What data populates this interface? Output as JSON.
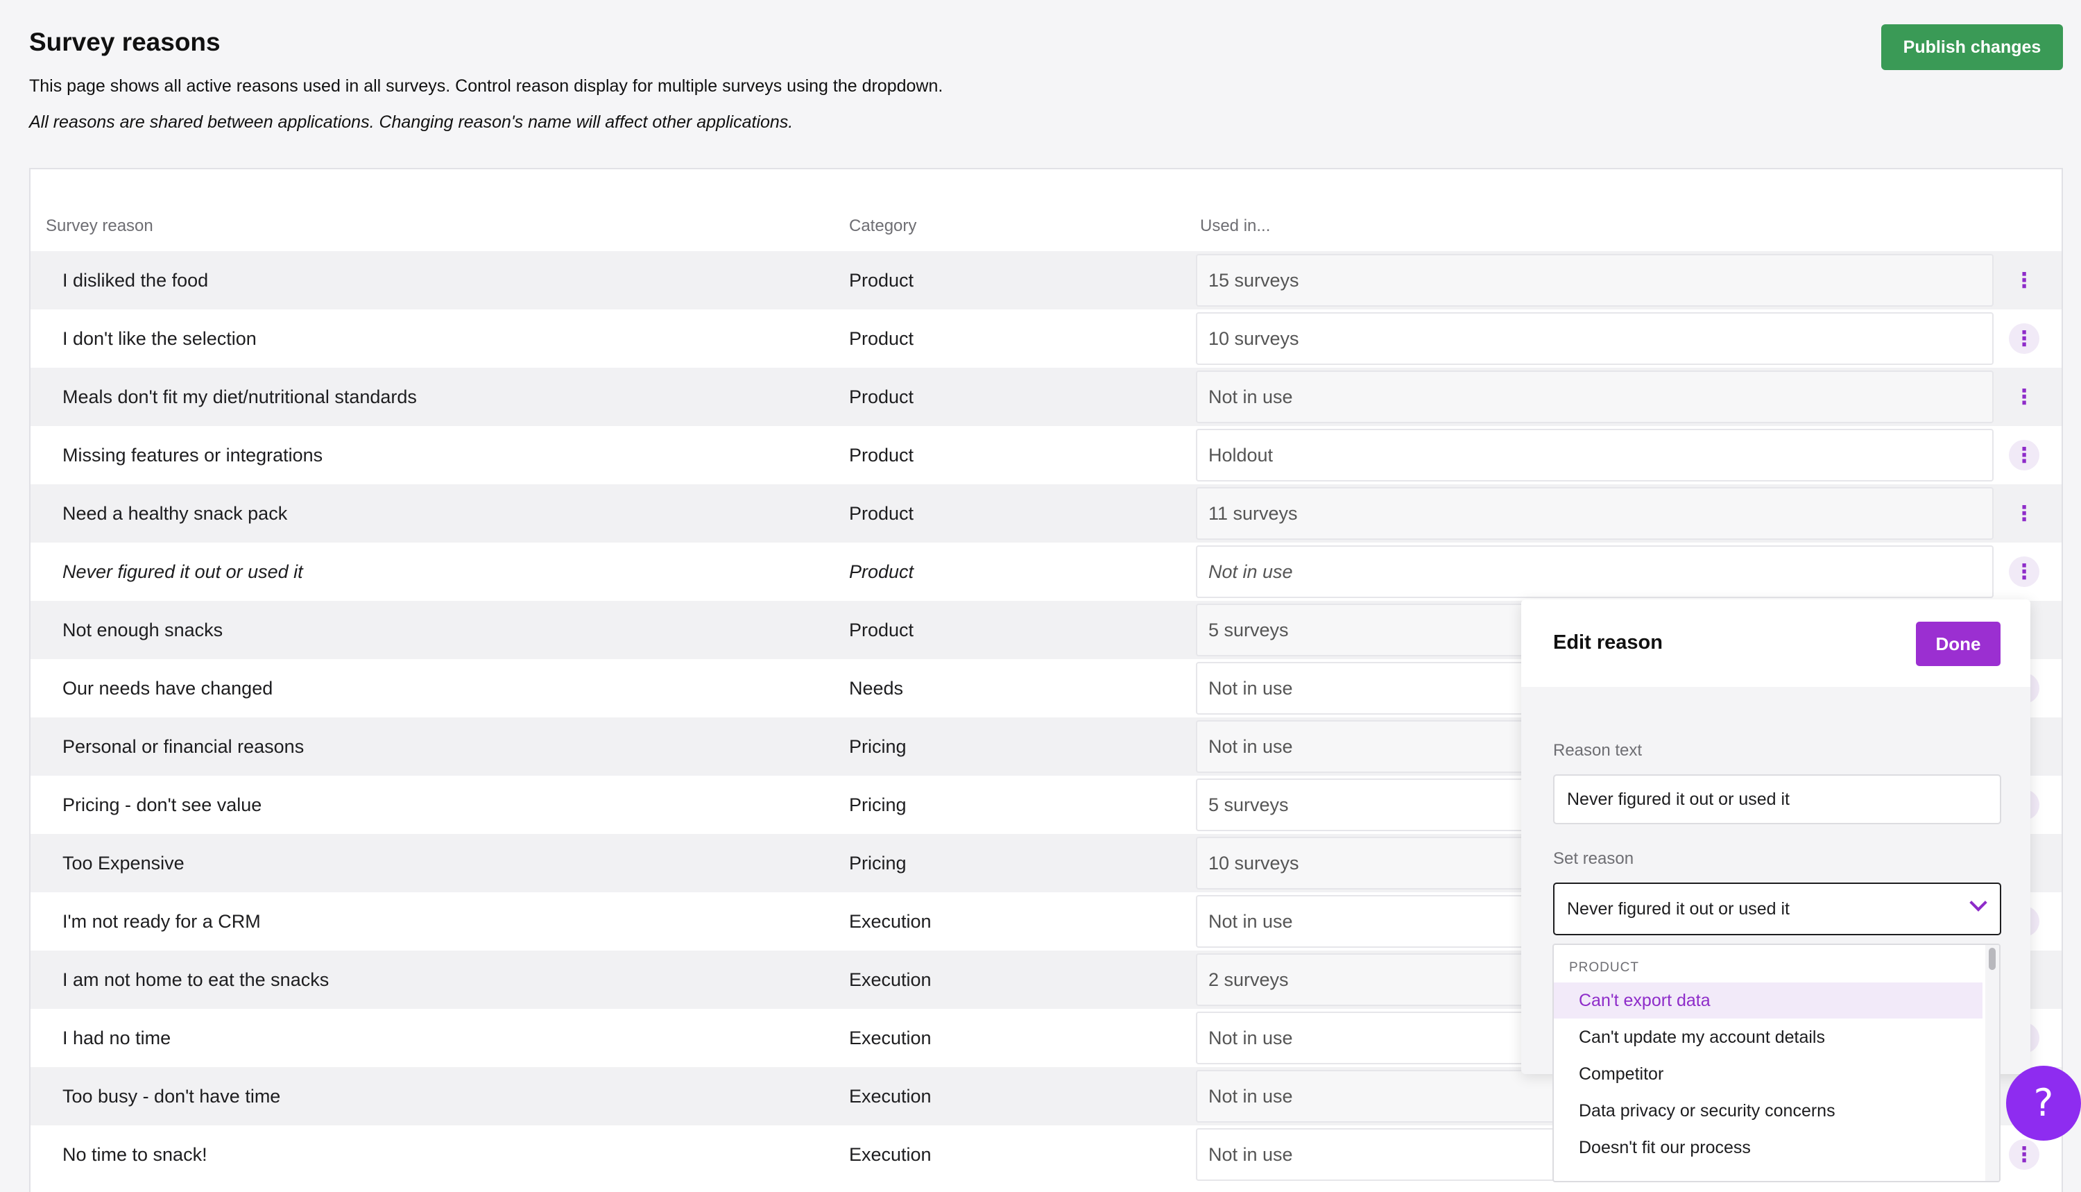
{
  "header": {
    "title": "Survey reasons",
    "subtitle": "This page shows all active reasons used in all surveys. Control reason display for multiple surveys using the dropdown.",
    "note": "All reasons are shared between applications. Changing reason's name will affect other applications.",
    "publish_label": "Publish changes"
  },
  "table": {
    "columns": {
      "reason": "Survey reason",
      "category": "Category",
      "used_in": "Used in..."
    },
    "rows": [
      {
        "reason": "I disliked the food",
        "category": "Product",
        "used_in": "15 surveys"
      },
      {
        "reason": "I don't like the selection",
        "category": "Product",
        "used_in": "10 surveys"
      },
      {
        "reason": "Meals don't fit my diet/nutritional standards",
        "category": "Product",
        "used_in": "Not in use"
      },
      {
        "reason": "Missing features or integrations",
        "category": "Product",
        "used_in": "Holdout"
      },
      {
        "reason": "Need a healthy snack pack",
        "category": "Product",
        "used_in": "11 surveys"
      },
      {
        "reason": "Never figured it out or used it",
        "category": "Product",
        "used_in": "Not in use"
      },
      {
        "reason": "Not enough snacks",
        "category": "Product",
        "used_in": "5 surveys"
      },
      {
        "reason": "Our needs have changed",
        "category": "Needs",
        "used_in": "Not in use"
      },
      {
        "reason": "Personal or financial reasons",
        "category": "Pricing",
        "used_in": "Not in use"
      },
      {
        "reason": "Pricing - don't see value",
        "category": "Pricing",
        "used_in": "5 surveys"
      },
      {
        "reason": "Too Expensive",
        "category": "Pricing",
        "used_in": "10 surveys"
      },
      {
        "reason": "I'm not ready for a CRM",
        "category": "Execution",
        "used_in": "Not in use"
      },
      {
        "reason": "I am not home to eat the snacks",
        "category": "Execution",
        "used_in": "2 surveys"
      },
      {
        "reason": "I had no time",
        "category": "Execution",
        "used_in": "Not in use"
      },
      {
        "reason": "Too busy - don't have time",
        "category": "Execution",
        "used_in": "Not in use"
      },
      {
        "reason": "No time to snack!",
        "category": "Execution",
        "used_in": "Not in use"
      }
    ]
  },
  "edit_panel": {
    "title": "Edit reason",
    "done_label": "Done",
    "reason_text_label": "Reason text",
    "reason_text_value": "Never figured it out or used it",
    "set_reason_label": "Set reason",
    "set_reason_value": "Never figured it out or used it",
    "dropdown": {
      "group": "PRODUCT",
      "options": [
        "Can't export data",
        "Can't update my account details",
        "Competitor",
        "Data privacy or security concerns",
        "Doesn't fit our process"
      ]
    }
  },
  "help": {
    "label": "?"
  },
  "colors": {
    "accent": "#9b2fd1",
    "publish": "#3a9a56",
    "help": "#8e2cf0"
  }
}
